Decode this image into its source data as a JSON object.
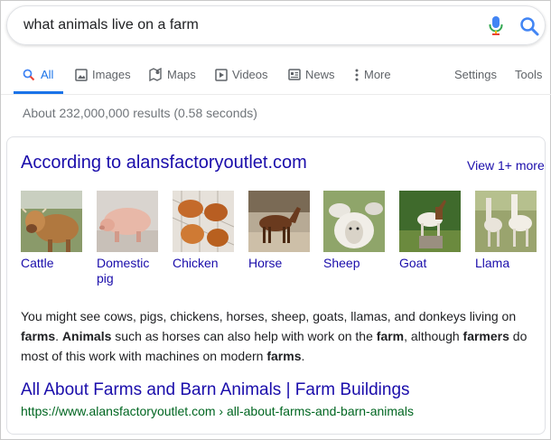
{
  "search": {
    "query": "what animals live on a farm"
  },
  "tabs": [
    {
      "label": "All",
      "icon": "search-icon",
      "active": true
    },
    {
      "label": "Images",
      "icon": "image-icon"
    },
    {
      "label": "Maps",
      "icon": "map-icon"
    },
    {
      "label": "Videos",
      "icon": "video-icon"
    },
    {
      "label": "News",
      "icon": "news-icon"
    },
    {
      "label": "More",
      "icon": "more-vert-icon"
    },
    {
      "label": "Settings"
    },
    {
      "label": "Tools"
    }
  ],
  "stats": "About 232,000,000 results (0.58 seconds)",
  "card": {
    "title": "According to alansfactoryoutlet.com",
    "view_more": "View 1+ more",
    "animals": [
      {
        "name": "Cattle"
      },
      {
        "name": "Domestic pig"
      },
      {
        "name": "Chicken"
      },
      {
        "name": "Horse"
      },
      {
        "name": "Sheep"
      },
      {
        "name": "Goat"
      },
      {
        "name": "Llama"
      }
    ],
    "snippet": {
      "p1": "You might see cows, pigs, chickens, horses, sheep, goats, llamas, and donkeys living on ",
      "b1": "farms",
      "p2": ". ",
      "b2": "Animals",
      "p3": " such as horses can also help with work on the ",
      "b3": "farm",
      "p4": ", although ",
      "b4": "farmers",
      "p5": " do most of this work with machines on modern ",
      "b5": "farms",
      "p6": "."
    },
    "result": {
      "title": "All About Farms and Barn Animals | Farm Buildings",
      "url": "https://www.alansfactoryoutlet.com › all-about-farms-and-barn-animals"
    }
  },
  "colors": {
    "link": "#1a0dab",
    "accent": "#1a73e8",
    "url_green": "#006621"
  }
}
